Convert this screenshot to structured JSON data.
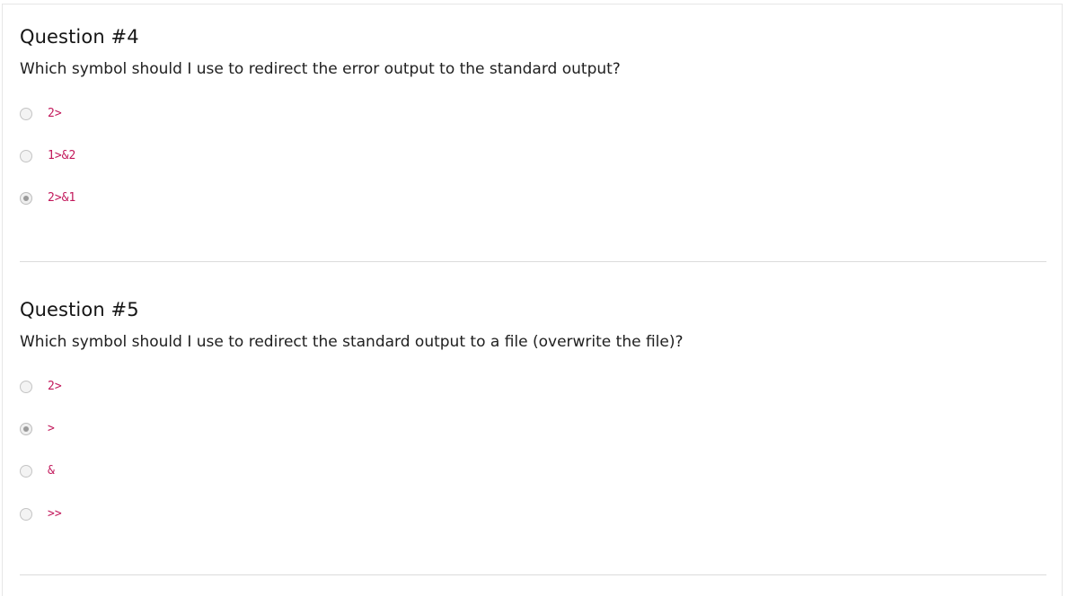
{
  "questions": [
    {
      "title": "Question #4",
      "text": "Which symbol should I use to redirect the error output to the standard output?",
      "options": [
        {
          "label": "2>",
          "selected": false
        },
        {
          "label": "1>&2",
          "selected": false
        },
        {
          "label": "2>&1",
          "selected": true
        }
      ]
    },
    {
      "title": "Question #5",
      "text": "Which symbol should I use to redirect the standard output to a file (overwrite the file)?",
      "options": [
        {
          "label": "2>",
          "selected": false
        },
        {
          "label": ">",
          "selected": true
        },
        {
          "label": "&",
          "selected": false
        },
        {
          "label": ">>",
          "selected": false
        }
      ]
    }
  ],
  "colors": {
    "code_text": "#c2185b",
    "divider": "#dcdcdc"
  }
}
